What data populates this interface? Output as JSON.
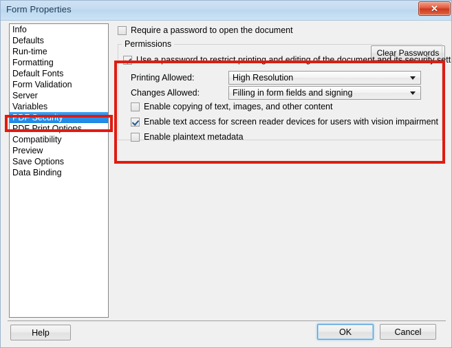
{
  "window": {
    "title": "Form Properties",
    "close_icon": "close-icon",
    "close_glyph": "✕"
  },
  "sidebar": {
    "items": [
      {
        "label": "Info",
        "selected": false
      },
      {
        "label": "Defaults",
        "selected": false
      },
      {
        "label": "Run-time",
        "selected": false
      },
      {
        "label": "Formatting",
        "selected": false
      },
      {
        "label": "Default Fonts",
        "selected": false
      },
      {
        "label": "Form Validation",
        "selected": false
      },
      {
        "label": "Server",
        "selected": false
      },
      {
        "label": "Variables",
        "selected": false
      },
      {
        "label": "PDF Security",
        "selected": true
      },
      {
        "label": "PDF Print Options",
        "selected": false
      },
      {
        "label": "Compatibility",
        "selected": false
      },
      {
        "label": "Preview",
        "selected": false
      },
      {
        "label": "Save Options",
        "selected": false
      },
      {
        "label": "Data Binding",
        "selected": false
      }
    ]
  },
  "main": {
    "require_password": {
      "label": "Require a password to open the document",
      "checked": false
    },
    "clear_passwords_label": "Clear Passwords",
    "permissions": {
      "legend": "Permissions",
      "use_password": {
        "label": "Use a password to restrict printing and editing of the document and its security settings",
        "checked": true
      },
      "printing_allowed": {
        "label": "Printing Allowed:",
        "value": "High Resolution"
      },
      "changes_allowed": {
        "label": "Changes Allowed:",
        "value": "Filling in form fields and signing"
      },
      "checkboxes": [
        {
          "label": "Enable copying of text, images, and other content",
          "checked": false
        },
        {
          "label": "Enable text access for screen reader devices for users with vision impairment",
          "checked": true
        },
        {
          "label": "Enable plaintext metadata",
          "checked": false
        }
      ]
    }
  },
  "footer": {
    "help_label": "Help",
    "ok_label": "OK",
    "cancel_label": "Cancel"
  },
  "annotations": {
    "color": "#e01b10",
    "boxes": [
      "permissions-panel",
      "pdf-security-item"
    ]
  },
  "colors": {
    "titlebar_blue": "#c3dbf0",
    "selection_blue": "#2086e2",
    "annotation_red": "#e01b10",
    "close_red": "#ca3a1f",
    "dialog_gray": "#f0f0f0"
  }
}
